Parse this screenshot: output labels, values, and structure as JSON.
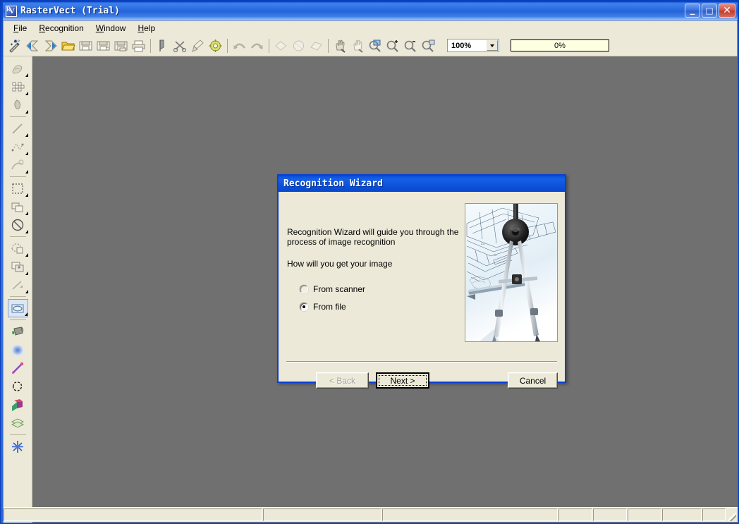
{
  "window": {
    "title": "RasterVect (Trial)",
    "icon": "app-icon",
    "controls": {
      "minimize": "_",
      "maximize": "□",
      "close": "✕"
    }
  },
  "menubar": {
    "items": [
      {
        "label": "File",
        "accel": "F"
      },
      {
        "label": "Recognition",
        "accel": "R"
      },
      {
        "label": "Window",
        "accel": "W"
      },
      {
        "label": "Help",
        "accel": "H"
      }
    ]
  },
  "toolbar": {
    "buttons": [
      {
        "name": "recognition-wizard-icon",
        "title": "Recognition Wizard"
      },
      {
        "name": "import-icon",
        "title": "Import"
      },
      {
        "name": "export-icon",
        "title": "Export"
      },
      {
        "name": "open-folder-icon",
        "title": "Open"
      },
      {
        "name": "save-icon",
        "title": "Save"
      },
      {
        "name": "save-as-icon",
        "title": "Save As"
      },
      {
        "name": "save-all-icon",
        "title": "Save All"
      },
      {
        "name": "print-icon",
        "title": "Print"
      },
      {
        "name": "separator",
        "title": ""
      },
      {
        "name": "magic-wand-icon",
        "title": "Select"
      },
      {
        "name": "scissors-icon",
        "title": "Cut"
      },
      {
        "name": "eraser-icon",
        "title": "Erase"
      },
      {
        "name": "gear-icon",
        "title": "Options"
      },
      {
        "name": "separator",
        "title": ""
      },
      {
        "name": "undo-icon",
        "title": "Undo"
      },
      {
        "name": "redo-icon",
        "title": "Redo"
      },
      {
        "name": "separator",
        "title": ""
      },
      {
        "name": "rotate-left-icon",
        "title": "Rotate Left"
      },
      {
        "name": "rotate-icon",
        "title": "Rotate"
      },
      {
        "name": "rotate-right-icon",
        "title": "Rotate Right"
      },
      {
        "name": "separator",
        "title": ""
      },
      {
        "name": "pan-hand-icon",
        "title": "Pan"
      },
      {
        "name": "grab-hand-icon",
        "title": "Grab"
      },
      {
        "name": "zoom-window-icon",
        "title": "Zoom Window"
      },
      {
        "name": "zoom-in-icon",
        "title": "Zoom In"
      },
      {
        "name": "zoom-out-icon",
        "title": "Zoom Out"
      },
      {
        "name": "zoom-fit-icon",
        "title": "Zoom Fit"
      }
    ],
    "zoom_value": "100%",
    "progress_value": "0%"
  },
  "left_toolbar": {
    "buttons": [
      {
        "name": "pointer-tool-icon"
      },
      {
        "name": "halftone-tool-icon"
      },
      {
        "name": "airbrush-tool-icon"
      },
      {
        "name": "separator"
      },
      {
        "name": "line-tool-icon"
      },
      {
        "name": "polyline-tool-icon"
      },
      {
        "name": "curve-tool-icon"
      },
      {
        "name": "separator"
      },
      {
        "name": "rect-select-tool-icon"
      },
      {
        "name": "shape-tool-icon"
      },
      {
        "name": "circle-slash-tool-icon"
      },
      {
        "name": "separator"
      },
      {
        "name": "lasso-copy-tool-icon"
      },
      {
        "name": "group-tool-icon"
      },
      {
        "name": "measure-line-tool-icon"
      },
      {
        "name": "separator"
      },
      {
        "name": "raster-object-tool-icon",
        "selected": true
      },
      {
        "name": "separator"
      },
      {
        "name": "paint-bucket-icon"
      },
      {
        "name": "blur-tool-icon"
      },
      {
        "name": "color-picker-icon"
      },
      {
        "name": "lasso-tool-icon"
      },
      {
        "name": "color-palette-icon"
      },
      {
        "name": "layers-icon"
      },
      {
        "name": "separator"
      },
      {
        "name": "snap-tool-icon"
      }
    ]
  },
  "statusbar": {
    "panels": [
      "",
      "",
      "",
      "",
      "",
      "",
      "",
      ""
    ]
  },
  "dialog": {
    "title": "Recognition Wizard",
    "paragraph1": "Recognition Wizard will guide you through the process of image recognition",
    "paragraph2": "How will you get your image",
    "options": [
      {
        "label": "From scanner",
        "checked": false,
        "enabled": false,
        "name": "radio-from-scanner"
      },
      {
        "label": "From file",
        "checked": true,
        "enabled": true,
        "name": "radio-from-file"
      }
    ],
    "picture_alt": "blueprint-with-compass",
    "buttons": {
      "back": "< Back",
      "next": "Next >",
      "cancel": "Cancel"
    },
    "back_enabled": false,
    "next_is_default": true
  },
  "colors": {
    "titlebar_blue": "#1f5fd8",
    "dialog_border_blue": "#0a3fd0",
    "face": "#ece9d8",
    "workspace_gray": "#707070",
    "progress_bg": "#ffffe1",
    "close_red": "#cf5647"
  }
}
